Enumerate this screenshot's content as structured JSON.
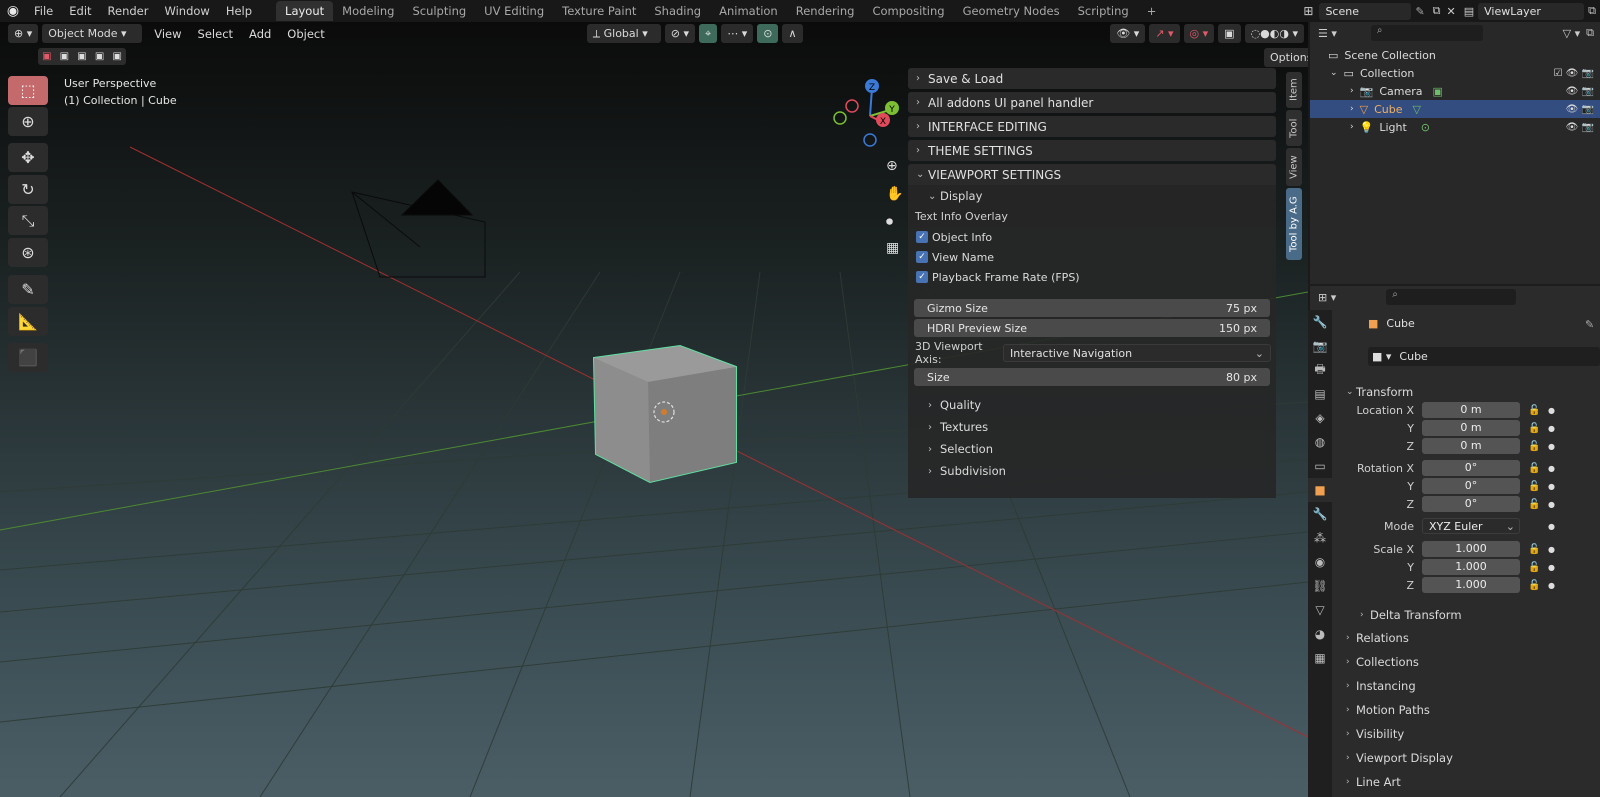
{
  "menu": [
    "File",
    "Edit",
    "Render",
    "Window",
    "Help"
  ],
  "workspaces": [
    "Layout",
    "Modeling",
    "Sculpting",
    "UV Editing",
    "Texture Paint",
    "Shading",
    "Animation",
    "Rendering",
    "Compositing",
    "Geometry Nodes",
    "Scripting"
  ],
  "add_workspace": "+",
  "scene_name": "Scene",
  "view_layer": "ViewLayer",
  "viewport_header": {
    "mode": "Object Mode",
    "menus": [
      "View",
      "Select",
      "Add",
      "Object"
    ],
    "orientation": "Global",
    "options": "Options"
  },
  "viewport_info": {
    "line1": "User Perspective",
    "line2": "(1) Collection | Cube"
  },
  "gizmo_axes": {
    "z": "Z",
    "y": "Y",
    "x": "X"
  },
  "npanel": {
    "headers": [
      "Save & Load",
      "All addons UI panel handler",
      "INTERFACE EDITING",
      "THEME SETTINGS",
      "VIEAWPORT SETTINGS"
    ],
    "display": "Display",
    "text_info_overlay": "Text Info Overlay",
    "checks": [
      "Object Info",
      "View Name",
      "Playback Frame Rate (FPS)"
    ],
    "gizmo_size": {
      "label": "Gizmo Size",
      "value": "75 px"
    },
    "hdri_size": {
      "label": "HDRI Preview Size",
      "value": "150 px"
    },
    "axis_label": "3D Viewport Axis:",
    "axis_value": "Interactive Navigation",
    "size": {
      "label": "Size",
      "value": "80 px"
    },
    "subsections": [
      "Quality",
      "Textures",
      "Selection",
      "Subdivision"
    ]
  },
  "side_tabs": [
    "Item",
    "Tool",
    "View",
    "Tool by A.G"
  ],
  "outliner": {
    "root": "Scene Collection",
    "collection": "Collection",
    "items": [
      "Camera",
      "Cube",
      "Light"
    ]
  },
  "properties": {
    "object_name": "Cube",
    "data_name": "Cube",
    "transform": "Transform",
    "location_label": "Location X",
    "rotation_label": "Rotation X",
    "scale_label": "Scale X",
    "y": "Y",
    "z": "Z",
    "location": [
      "0 m",
      "0 m",
      "0 m"
    ],
    "rotation": [
      "0°",
      "0°",
      "0°"
    ],
    "mode_label": "Mode",
    "mode_value": "XYZ Euler",
    "scale": [
      "1.000",
      "1.000",
      "1.000"
    ],
    "delta": "Delta Transform",
    "sections": [
      "Relations",
      "Collections",
      "Instancing",
      "Motion Paths",
      "Visibility",
      "Viewport Display",
      "Line Art"
    ]
  },
  "colors": {
    "accent": "#4772b3",
    "selected": "#334d80",
    "cube_outline": "#5fe0a0",
    "tool_active": "#c46a6c"
  }
}
